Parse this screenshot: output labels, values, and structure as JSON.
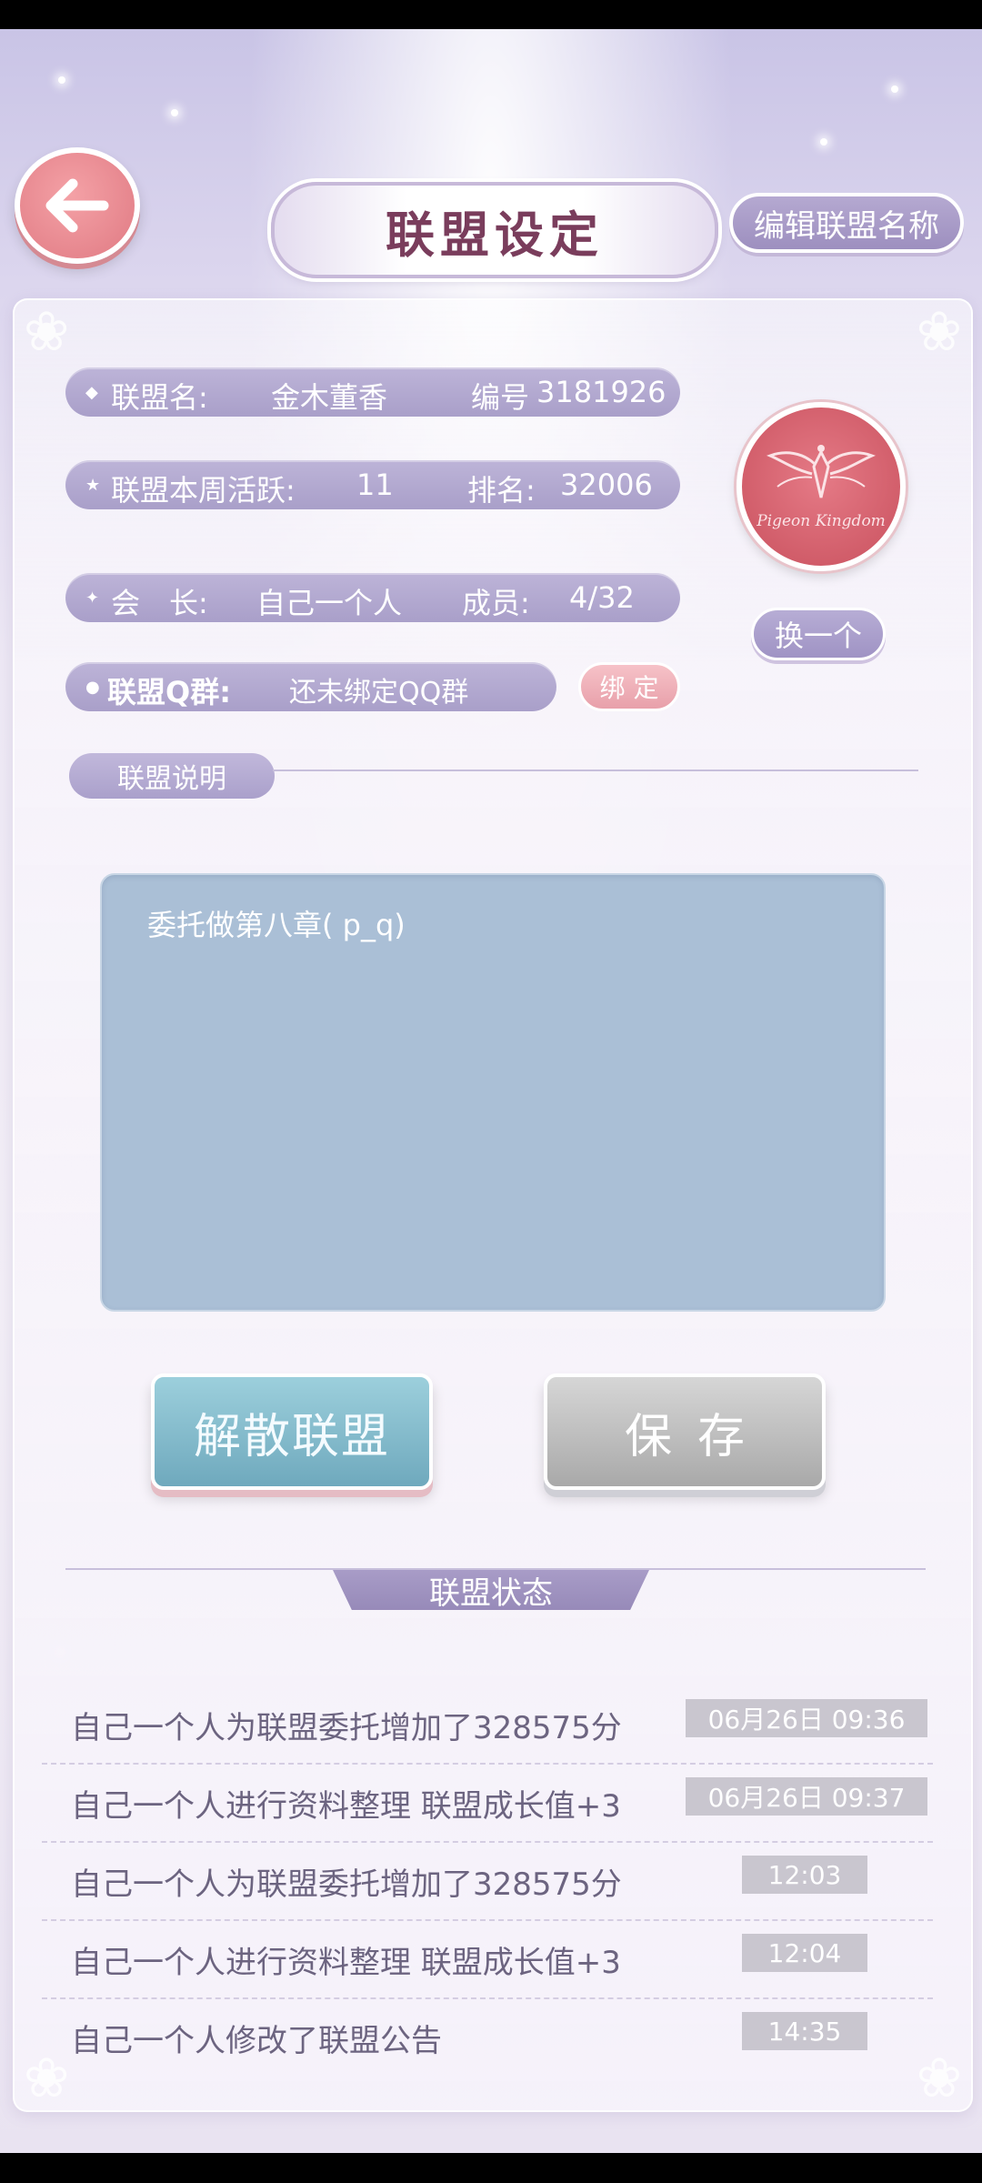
{
  "header": {
    "back_icon": "arrow-left-icon",
    "title": "联盟设定",
    "edit_name_label": "编辑联盟名称"
  },
  "info": {
    "name_label": "联盟名:",
    "name_value": "金木董香",
    "id_label": "编号",
    "id_value": "3181926",
    "activity_label": "联盟本周活跃:",
    "activity_value": "11",
    "rank_label": "排名:",
    "rank_value": "32006",
    "leader_label": "会　长:",
    "leader_value": "自己一个人",
    "members_label": "成员:",
    "members_value": "4/32",
    "qq_label": "联盟Q群:",
    "qq_value": "还未绑定QQ群",
    "bind_label": "绑 定"
  },
  "emblem": {
    "text": "Pigeon Kingdom",
    "swap_label": "换一个"
  },
  "description": {
    "section_label": "联盟说明",
    "text": "委托做第八章( p_q)"
  },
  "actions": {
    "dissolve_label": "解散联盟",
    "save_label": "保存"
  },
  "status": {
    "title": "联盟状态",
    "logs": [
      {
        "text": "自己一个人为联盟委托增加了328575分",
        "time": "06月26日 09:36"
      },
      {
        "text": "自己一个人进行资料整理 联盟成长值+3",
        "time": "06月26日 09:37"
      },
      {
        "text": "自己一个人为联盟委托增加了328575分",
        "time": "12:03"
      },
      {
        "text": "自己一个人进行资料整理 联盟成长值+3",
        "time": "12:04"
      },
      {
        "text": "自己一个人修改了联盟公告",
        "time": "14:35"
      }
    ]
  },
  "colors": {
    "accent_purple": "#a99fc9",
    "accent_pink": "#e07a83",
    "desc_box": "#aabfd6"
  }
}
